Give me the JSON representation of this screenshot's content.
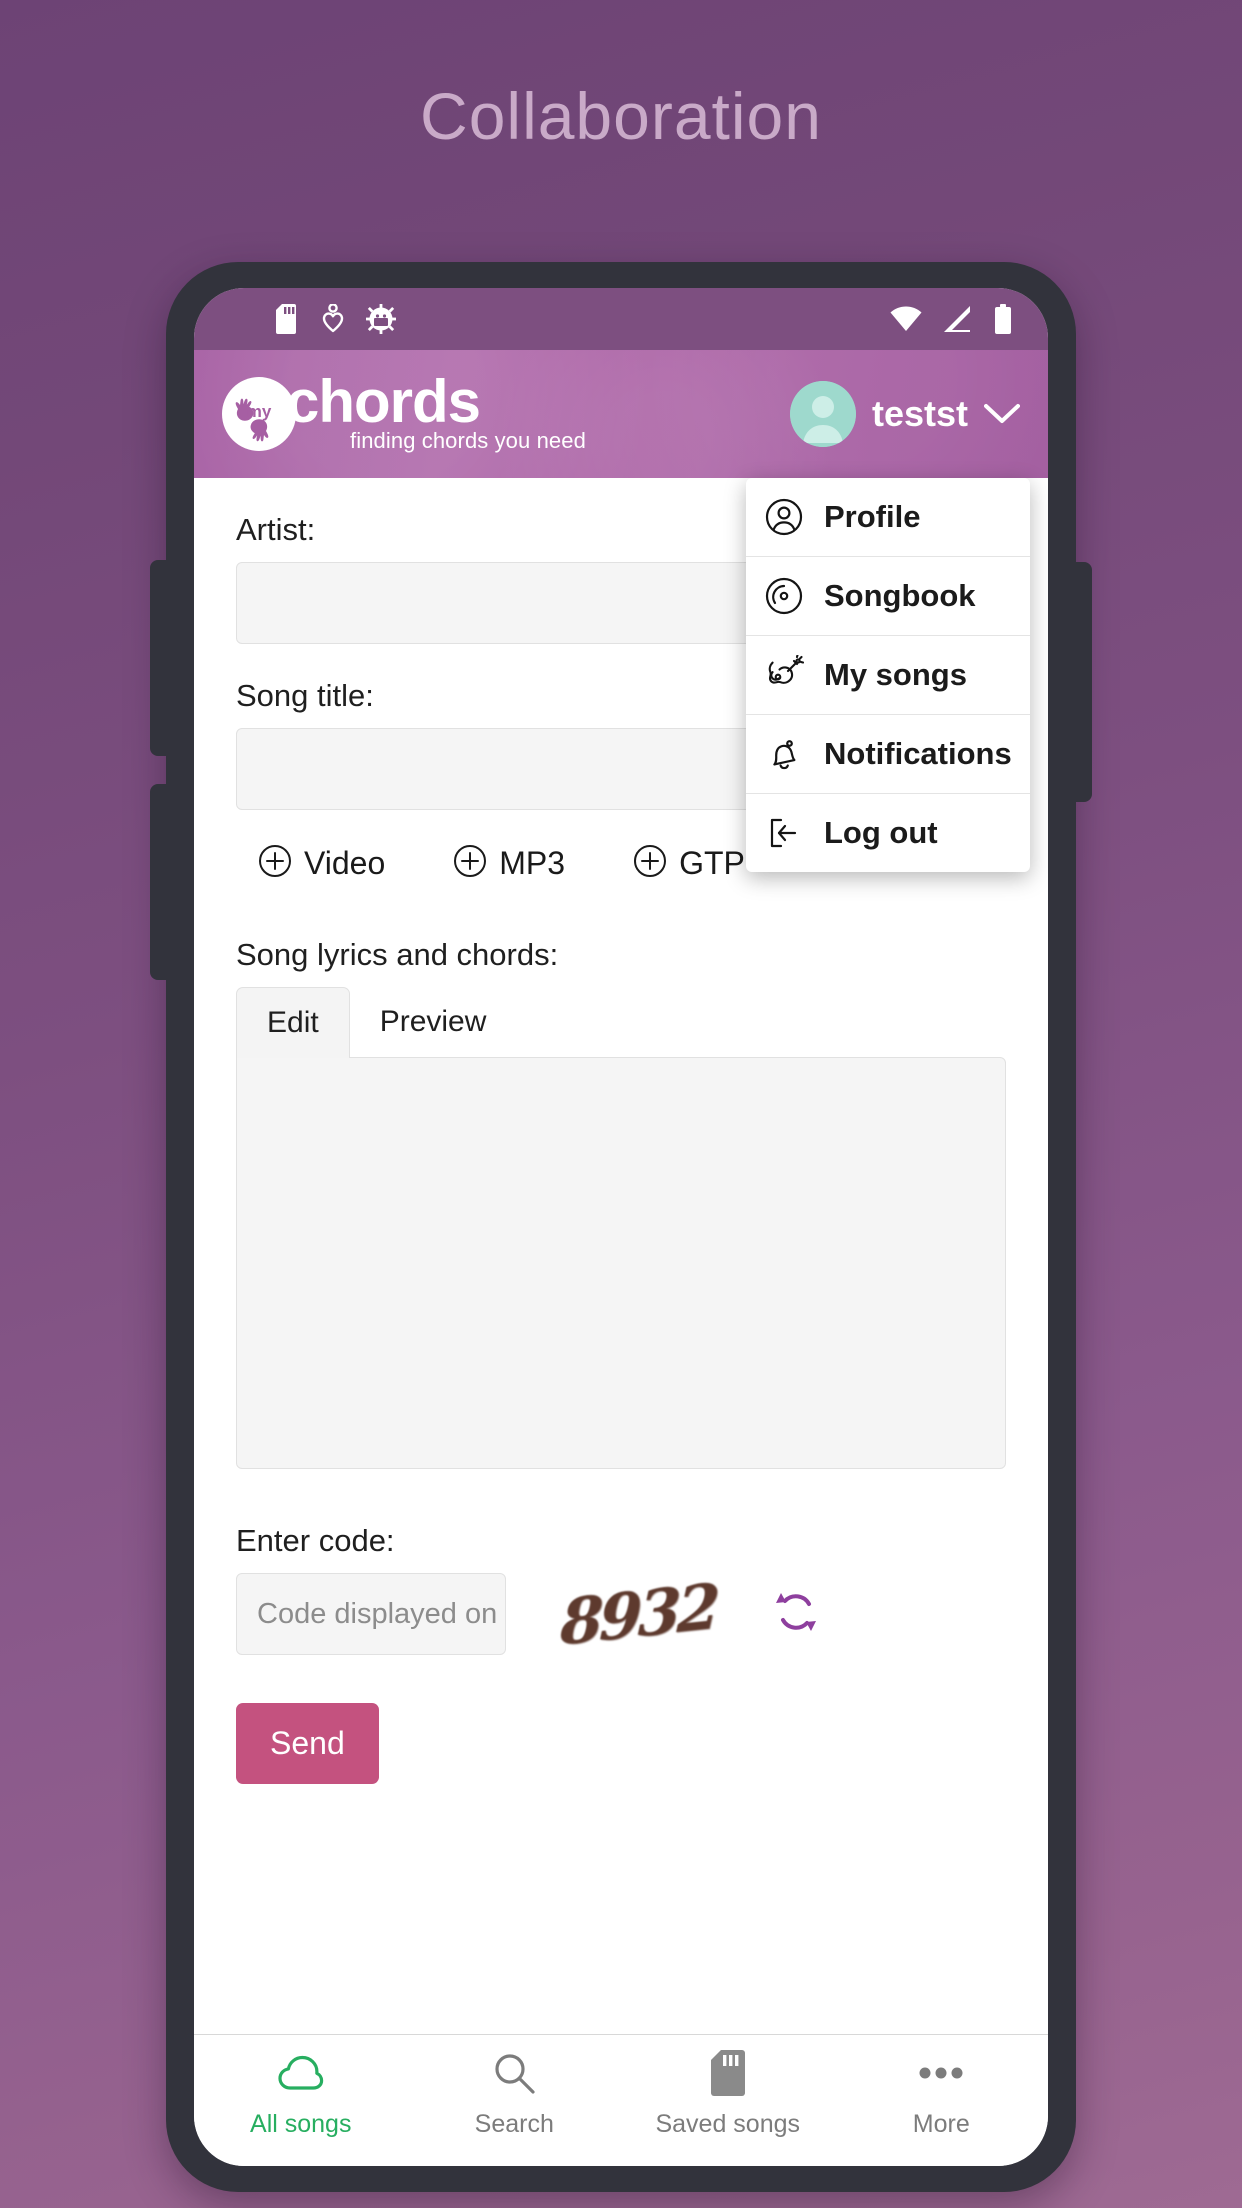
{
  "page": {
    "title": "Collaboration",
    "title_color": "#c9aac8",
    "background_color": "#7d4f80"
  },
  "status_bar": {
    "left_icons": [
      "sd-card-icon",
      "heart-icon",
      "android-gear-icon"
    ],
    "right_icons": [
      "wifi-icon",
      "signal-icon",
      "battery-icon"
    ]
  },
  "app_header": {
    "logo_icon": "mychords-hands-logo-icon",
    "logo_main": "chords",
    "logo_prefix": "my",
    "logo_tagline": "finding chords you need",
    "accent_color": "#a65fa3",
    "user": {
      "avatar_icon": "user-avatar-icon",
      "avatar_color": "#9ed9cd",
      "name": "testst",
      "chevron_icon": "chevron-down-icon"
    }
  },
  "user_menu": {
    "items": [
      {
        "label": "Profile",
        "icon": "user-circle-icon"
      },
      {
        "label": "Songbook",
        "icon": "vinyl-disc-icon"
      },
      {
        "label": "My songs",
        "icon": "guitar-icon"
      },
      {
        "label": "Notifications",
        "icon": "bell-icon"
      },
      {
        "label": "Log out",
        "icon": "logout-icon"
      }
    ]
  },
  "form": {
    "artist_label": "Artist:",
    "artist_value": "",
    "song_title_label": "Song title:",
    "song_title_value": "",
    "attachments": [
      {
        "label": "Video",
        "icon": "plus-circle-icon"
      },
      {
        "label": "MP3",
        "icon": "plus-circle-icon"
      },
      {
        "label": "GTP",
        "icon": "plus-circle-icon"
      }
    ],
    "lyrics_label": "Song lyrics and chords:",
    "tabs": [
      {
        "label": "Edit",
        "active": true
      },
      {
        "label": "Preview",
        "active": false
      }
    ],
    "editor_value": "",
    "code_label": "Enter code:",
    "code_placeholder": "Code displayed on",
    "code_value": "",
    "captcha_text": "8932",
    "refresh_icon": "refresh-icon",
    "refresh_color": "#8e3f9e",
    "send_label": "Send",
    "send_color": "#c4527f"
  },
  "bottom_nav": {
    "active_color": "#27ae60",
    "items": [
      {
        "label": "All songs",
        "icon": "cloud-icon",
        "active": true
      },
      {
        "label": "Search",
        "icon": "search-icon",
        "active": false
      },
      {
        "label": "Saved songs",
        "icon": "sd-card-icon",
        "active": false
      },
      {
        "label": "More",
        "icon": "ellipsis-icon",
        "active": false
      }
    ]
  }
}
